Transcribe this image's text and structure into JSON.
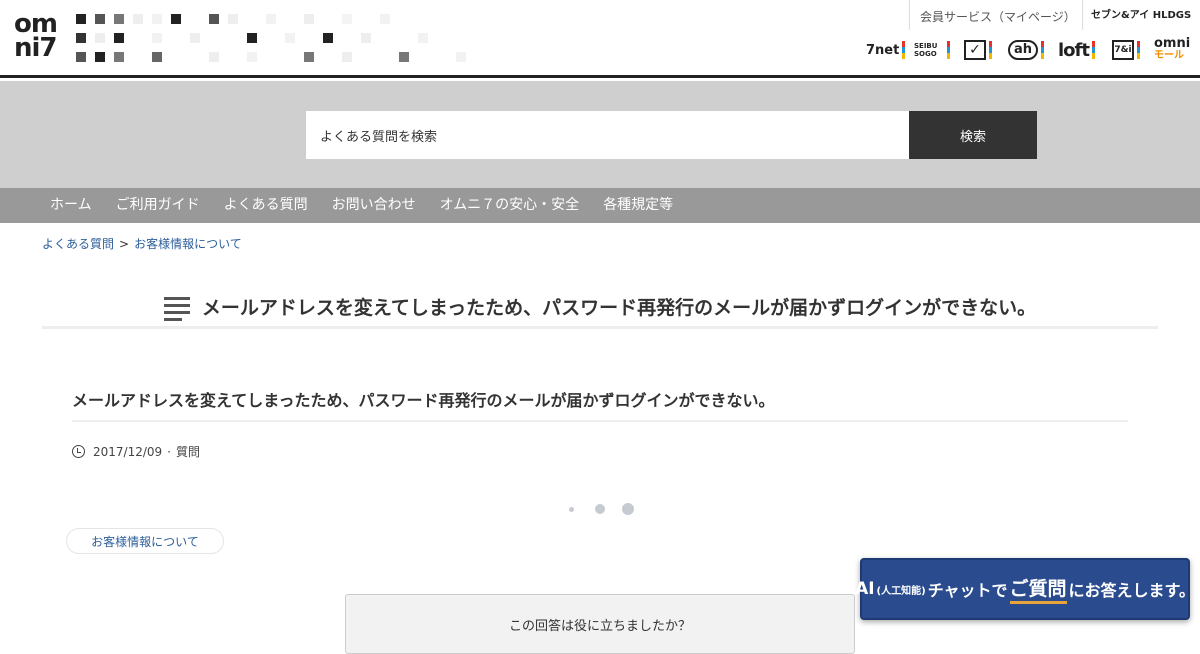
{
  "header": {
    "logo_text": "omni7",
    "member_service": "会員サービス（マイページ）",
    "hldgs_label": "セブン&アイ HLDGS",
    "brands": [
      {
        "label": "7net",
        "icon": "7net-logo"
      },
      {
        "label": "SEIBU SOGO",
        "icon": "seibu-sogo-logo"
      },
      {
        "label": "✓",
        "icon": "ito-yokado-logo"
      },
      {
        "label": "ah",
        "icon": "akachan-honpo-logo"
      },
      {
        "label": "loft",
        "icon": "loft-logo"
      },
      {
        "label": "7&i",
        "icon": "seven-eleven-logo"
      },
      {
        "label": "omni",
        "icon": "omni-mall-logo"
      }
    ]
  },
  "search": {
    "placeholder": "よくある質問を検索",
    "button_label": "検索"
  },
  "nav": {
    "items": [
      "ホーム",
      "ご利用ガイド",
      "よくある質問",
      "お問い合わせ",
      "オムニ７の安心・安全",
      "各種規定等"
    ]
  },
  "breadcrumb": {
    "items": [
      "よくある質問",
      "お客様情報について"
    ],
    "separator": ">"
  },
  "page": {
    "heading": "メールアドレスを変えてしまったため、パスワード再発行のメールが届かずログインができない。"
  },
  "question": {
    "title": "メールアドレスを変えてしまったため、パスワード再発行のメールが届かずログインができない。",
    "date": "2017/12/09",
    "type": "質問"
  },
  "tag": {
    "label": "お客様情報について"
  },
  "feedback": {
    "prompt": "この回答は役に立ちましたか？"
  },
  "ai_chat": {
    "ai": "AI",
    "ai_note": "(人工知能)",
    "chat": "チャットで",
    "question": "ご質問",
    "answer": "にお答えします。"
  },
  "colors": {
    "nav_bg": "#999999",
    "search_band": "#cfcfcf",
    "link": "#2d5f9a",
    "chat_bg": "#2b4b8f",
    "chat_underline": "#e8a33b"
  }
}
